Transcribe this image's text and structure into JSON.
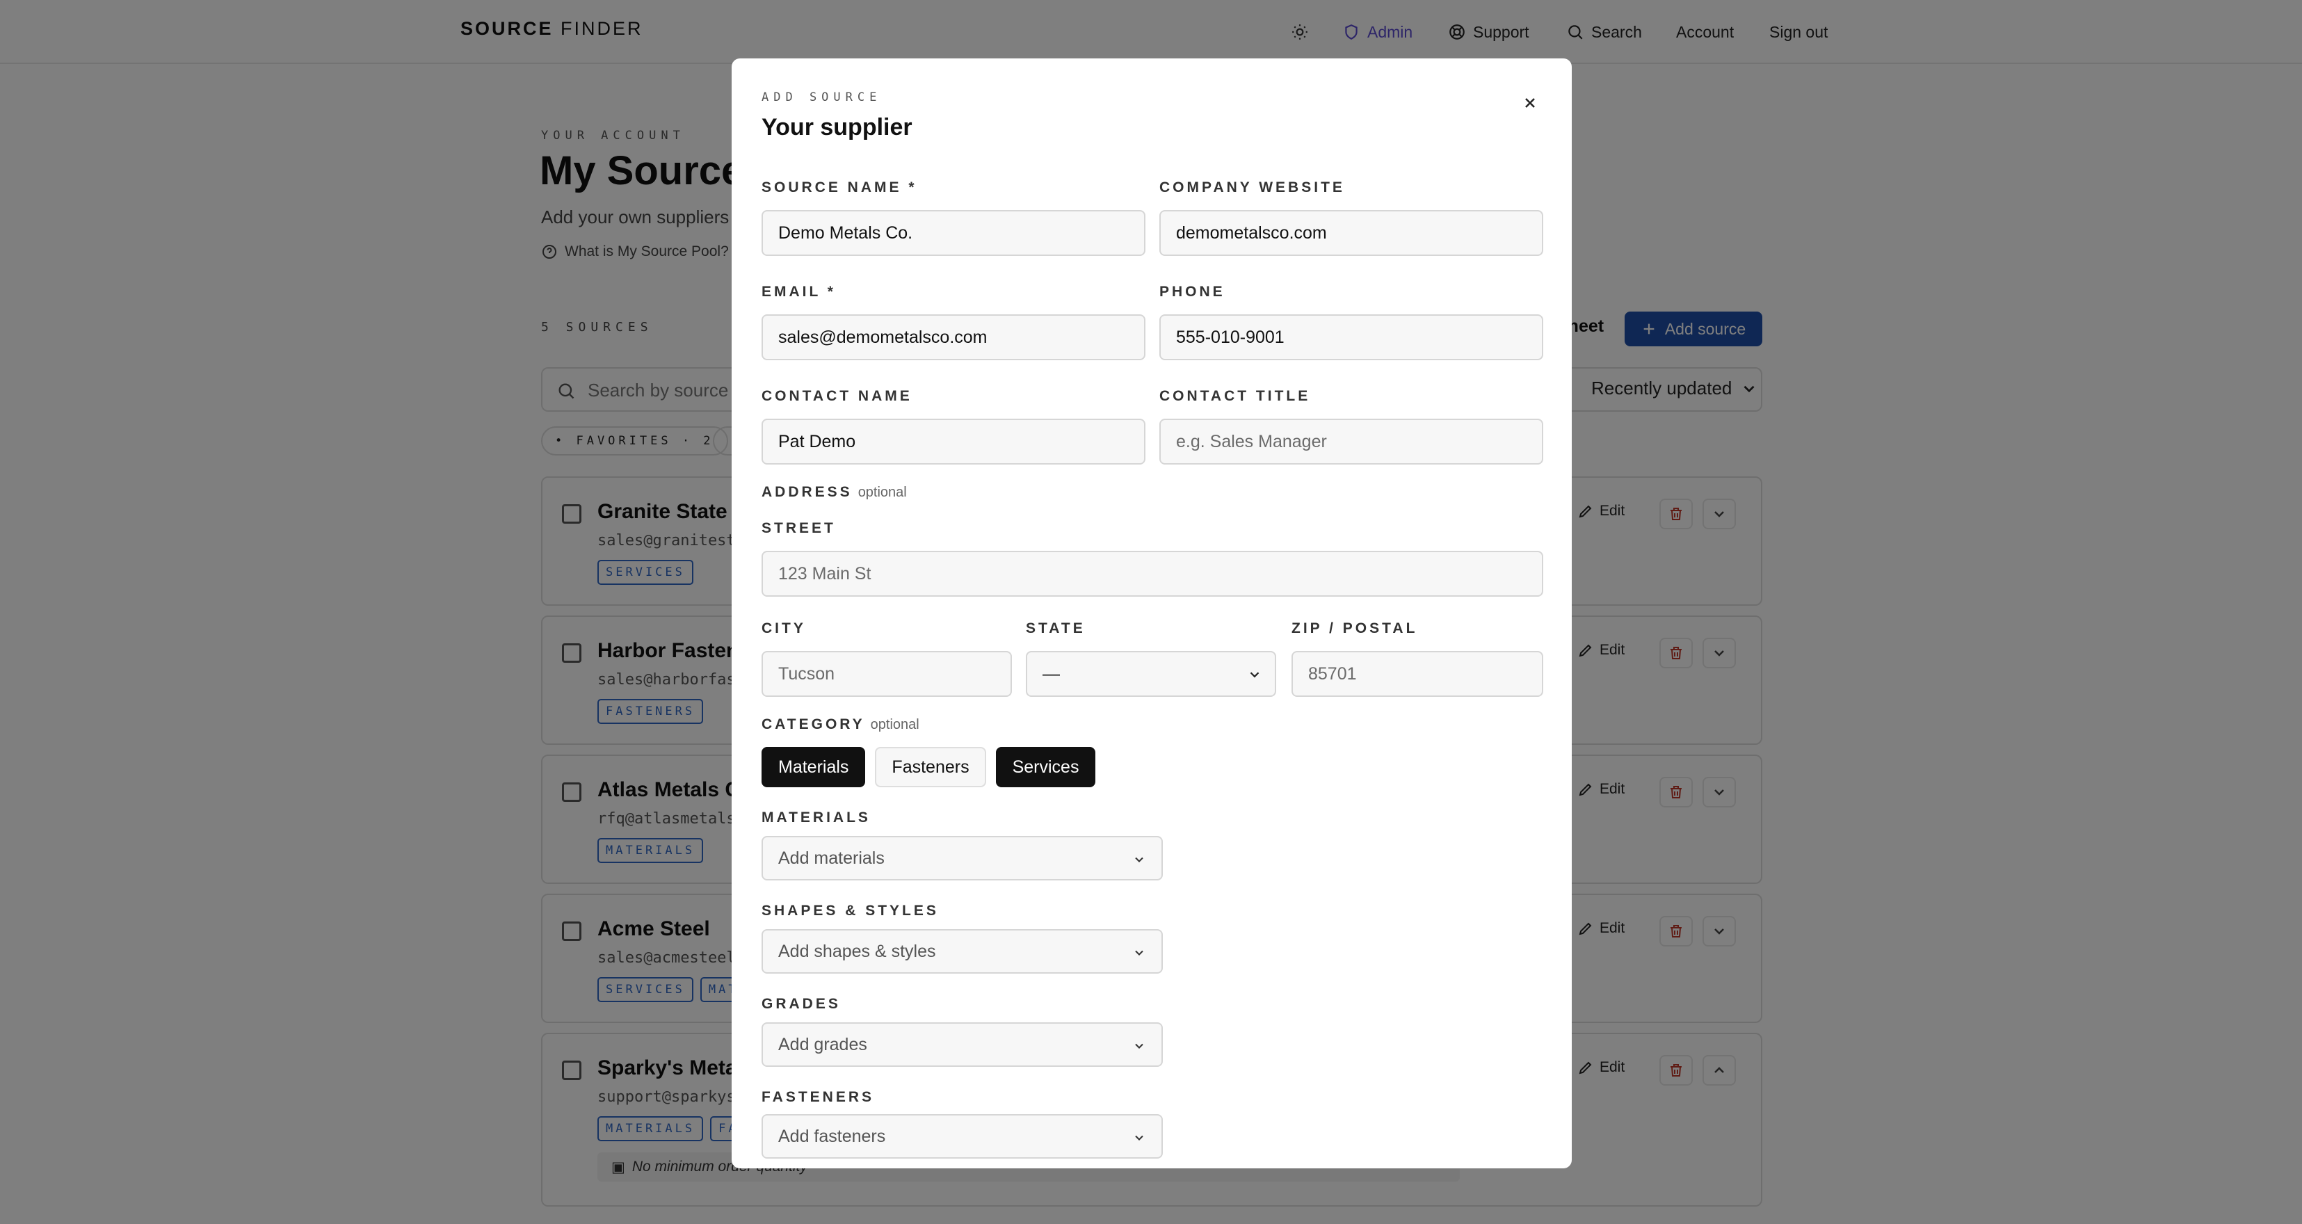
{
  "topbar": {
    "brand_bold": "SOURCE",
    "brand_rest": "FINDER",
    "nav": {
      "admin": "Admin",
      "support": "Support",
      "search": "Search",
      "account": "Account",
      "signout": "Sign out"
    }
  },
  "page": {
    "eyebrow": "YOUR ACCOUNT",
    "title": "My Source Pool",
    "subtitle": "Add your own suppliers",
    "help_link": "What is My Source Pool?",
    "count": "5 SOURCES",
    "sheet_link": "Sheet",
    "add_source": "Add source",
    "search_placeholder": "Search by source name",
    "sort_label": "Recently updated",
    "favorites_chip": "• FAVORITES · 2",
    "cards": [
      {
        "name": "Granite State Supply",
        "email": "sales@granitestate.com",
        "tags": [
          "SERVICES"
        ],
        "edit": "Edit",
        "expanded": false
      },
      {
        "name": "Harbor Fasteners",
        "email": "sales@harborfasteners.com",
        "tags": [
          "FASTENERS"
        ],
        "edit": "Edit",
        "expanded": false
      },
      {
        "name": "Atlas Metals Co.",
        "email": "rfq@atlasmetals.com",
        "tags": [
          "MATERIALS"
        ],
        "edit": "Edit",
        "expanded": false
      },
      {
        "name": "Acme Steel",
        "email": "sales@acmesteel.com",
        "tags": [
          "SERVICES",
          "MATERIALS"
        ],
        "edit": "Edit",
        "expanded": false
      },
      {
        "name": "Sparky's Metals",
        "email": "support@sparkysmetals.com",
        "tags": [
          "MATERIALS",
          "FASTENERS"
        ],
        "edit": "Edit",
        "expanded": true,
        "note": "No minimum order quantity"
      }
    ]
  },
  "modal": {
    "eyebrow": "ADD SOURCE",
    "title": "Your supplier",
    "fields": {
      "source_name": {
        "label": "SOURCE NAME *",
        "value": "Demo Metals Co."
      },
      "company_website": {
        "label": "COMPANY WEBSITE",
        "value": "demometalsco.com"
      },
      "email": {
        "label": "EMAIL *",
        "value": "sales@demometalsco.com"
      },
      "phone": {
        "label": "PHONE",
        "value": "555-010-9001"
      },
      "contact_name": {
        "label": "CONTACT NAME",
        "value": "Pat Demo"
      },
      "contact_title": {
        "label": "CONTACT TITLE",
        "placeholder": "e.g. Sales Manager"
      }
    },
    "address": {
      "label": "ADDRESS",
      "optional": "optional",
      "street": {
        "label": "STREET",
        "placeholder": "123 Main St"
      },
      "city": {
        "label": "CITY",
        "placeholder": "Tucson"
      },
      "state": {
        "label": "STATE",
        "value": "—"
      },
      "zip": {
        "label": "ZIP / POSTAL",
        "placeholder": "85701"
      }
    },
    "category": {
      "label": "CATEGORY",
      "optional": "optional",
      "options": [
        {
          "label": "Materials",
          "selected": true
        },
        {
          "label": "Fasteners",
          "selected": false
        },
        {
          "label": "Services",
          "selected": true
        }
      ]
    },
    "selects": [
      {
        "label": "MATERIALS",
        "placeholder": "Add materials"
      },
      {
        "label": "SHAPES & STYLES",
        "placeholder": "Add shapes & styles"
      },
      {
        "label": "GRADES",
        "placeholder": "Add grades"
      },
      {
        "label": "FASTENERS",
        "placeholder": "Add fasteners"
      }
    ]
  }
}
